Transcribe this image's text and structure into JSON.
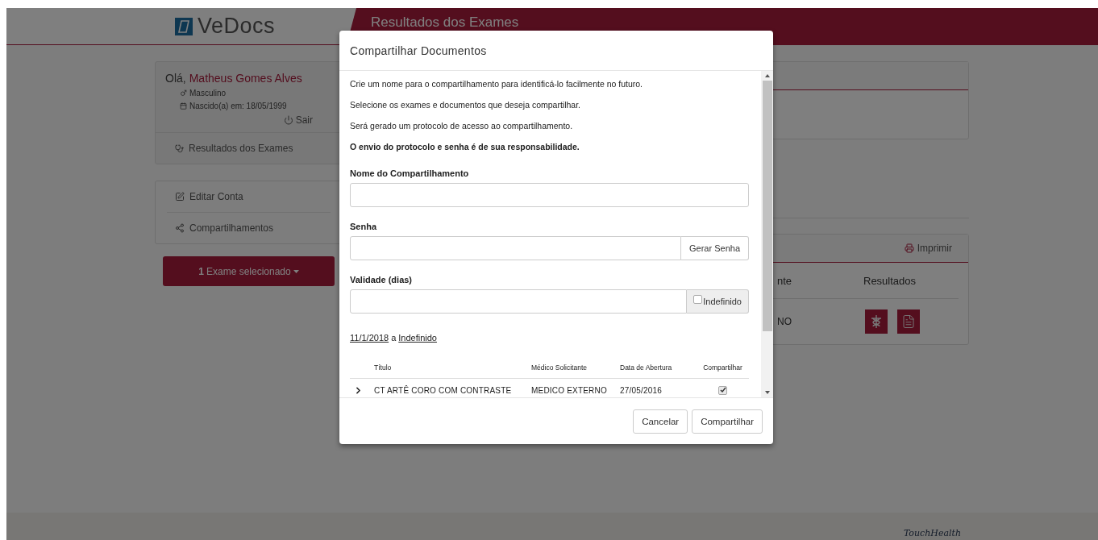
{
  "header": {
    "logo": "VeDocs",
    "title": "Resultados dos Exames"
  },
  "profile": {
    "greeting": "Olá,",
    "name": "Matheus Gomes Alves",
    "gender": "Masculino",
    "birth": "Nascido(a) em: 18/05/1999",
    "logout": "Sair",
    "menu_item": "Resultados dos Exames"
  },
  "account_menu": [
    {
      "kind": "edit",
      "label": "Editar Conta"
    },
    {
      "kind": "share",
      "label": "Compartilhamentos"
    }
  ],
  "selection_button": {
    "count": "1",
    "label": "Exame selecionado"
  },
  "results_panel": {
    "print": "Imprimir",
    "columns": [
      "nte",
      "Resultados"
    ],
    "rows": [
      {
        "cells": [
          "NO"
        ]
      }
    ]
  },
  "modal": {
    "title": "Compartilhar Documentos",
    "notes": [
      {
        "text": "Crie um nome para o compartilhamento para identificá-lo facilmente no futuro.",
        "bold": false
      },
      {
        "text": "Selecione os exames e documentos que deseja compartilhar.",
        "bold": false
      },
      {
        "text": "Será gerado um protocolo de acesso ao compartilhamento.",
        "bold": false
      },
      {
        "text": "O envio do protocolo e senha é de sua responsabilidade.",
        "bold": true
      }
    ],
    "fields": [
      {
        "kind": "plain",
        "label": "Nome do Compartilhamento"
      },
      {
        "kind": "button",
        "label": "Senha",
        "addon": "Gerar Senha"
      },
      {
        "kind": "checkbox",
        "label": "Validade (dias)",
        "addon": "Indefinido",
        "checked": false
      }
    ],
    "period": {
      "start": "11/1/2018",
      "separator": "a",
      "end": "Indefinido"
    },
    "columns": [
      "Título",
      "Médico Solicitante",
      "Data de Abertura",
      "Compartilhar"
    ],
    "rows": [
      {
        "expanded": false,
        "title": "CT ARTÊ CORO COM CONTRASTE",
        "doctor": "MEDICO EXTERNO",
        "date": "27/05/2016",
        "checked": true
      }
    ],
    "buttons": [
      "Cancelar",
      "Compartilhar"
    ]
  },
  "footer": {
    "logo": "TouchHealth"
  }
}
